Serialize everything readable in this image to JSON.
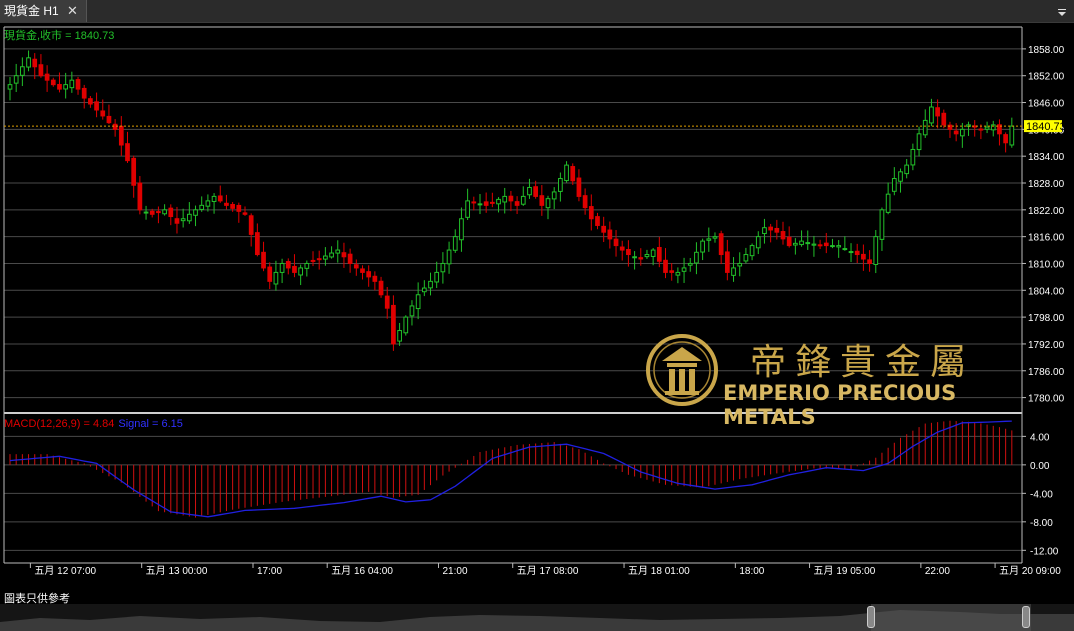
{
  "tab": {
    "title": "現貨金 H1",
    "close": "✕"
  },
  "price_label": "現貨金,收市 = 1840.73",
  "last_price": "1840.73",
  "macd_label": "MACD(12,26,9) = 4.84",
  "signal_label": "Signal = 6.15",
  "footer": "圖表只供參考",
  "logo": {
    "cn": "帝鋒貴金屬",
    "en": "EMPERIO PRECIOUS METALS"
  },
  "colors": {
    "up": "#22c02a",
    "down": "#e00000",
    "signal": "#2020e0",
    "macd_hist": "#d01010",
    "axis_text": "#ffffff",
    "price_line": "#e0a000",
    "price_box": "#ffff00",
    "label_green": "#22c02a",
    "label_red": "#e00000",
    "label_blue": "#3030ff"
  },
  "chart_data": [
    {
      "type": "candlestick",
      "ylim": [
        1777,
        1862
      ],
      "y_ticks": [
        "1858.00",
        "1852.00",
        "1846.00",
        "1840.00",
        "1834.00",
        "1828.00",
        "1822.00",
        "1816.00",
        "1810.00",
        "1804.00",
        "1798.00",
        "1792.00",
        "1786.00",
        "1780.00"
      ],
      "y_tick_values": [
        1858,
        1852,
        1846,
        1840,
        1834,
        1828,
        1822,
        1816,
        1810,
        1804,
        1798,
        1792,
        1786,
        1780
      ],
      "x_ticks": [
        {
          "label": "五月 12 07:00",
          "index": 2
        },
        {
          "label": "五月 13 00:00",
          "index": 20
        },
        {
          "label": "17:00",
          "index": 38
        },
        {
          "label": "五月 16 04:00",
          "index": 50
        },
        {
          "label": "21:00",
          "index": 68
        },
        {
          "label": "五月 17 08:00",
          "index": 80
        },
        {
          "label": "五月 18 01:00",
          "index": 98
        },
        {
          "label": "18:00",
          "index": 116
        },
        {
          "label": "五月 19 05:00",
          "index": 128
        },
        {
          "label": "22:00",
          "index": 146
        },
        {
          "label": "五月 20 09:00",
          "index": 158
        }
      ],
      "close_anchors": [
        [
          0,
          1850
        ],
        [
          3,
          1856
        ],
        [
          5,
          1852
        ],
        [
          8,
          1849
        ],
        [
          10,
          1851
        ],
        [
          12,
          1847
        ],
        [
          15,
          1843
        ],
        [
          17,
          1840
        ],
        [
          19,
          1833
        ],
        [
          21,
          1822
        ],
        [
          23,
          1821
        ],
        [
          25,
          1822
        ],
        [
          27,
          1819
        ],
        [
          30,
          1822
        ],
        [
          33,
          1825
        ],
        [
          35,
          1823
        ],
        [
          38,
          1821
        ],
        [
          40,
          1812
        ],
        [
          42,
          1806
        ],
        [
          44,
          1810
        ],
        [
          46,
          1808
        ],
        [
          48,
          1810
        ],
        [
          50,
          1811
        ],
        [
          53,
          1813
        ],
        [
          55,
          1810
        ],
        [
          57,
          1808
        ],
        [
          59,
          1806
        ],
        [
          61,
          1800
        ],
        [
          62,
          1792
        ],
        [
          64,
          1798
        ],
        [
          66,
          1803
        ],
        [
          68,
          1806
        ],
        [
          70,
          1810
        ],
        [
          72,
          1816
        ],
        [
          74,
          1824
        ],
        [
          77,
          1823
        ],
        [
          80,
          1825
        ],
        [
          82,
          1823
        ],
        [
          84,
          1827
        ],
        [
          86,
          1823
        ],
        [
          88,
          1826
        ],
        [
          90,
          1832
        ],
        [
          92,
          1825
        ],
        [
          94,
          1820
        ],
        [
          96,
          1817
        ],
        [
          98,
          1814
        ],
        [
          100,
          1812
        ],
        [
          102,
          1811
        ],
        [
          104,
          1813
        ],
        [
          106,
          1808
        ],
        [
          108,
          1808
        ],
        [
          110,
          1810
        ],
        [
          112,
          1815
        ],
        [
          114,
          1816
        ],
        [
          116,
          1808
        ],
        [
          118,
          1810
        ],
        [
          120,
          1814
        ],
        [
          122,
          1818
        ],
        [
          124,
          1817
        ],
        [
          126,
          1814
        ],
        [
          128,
          1815
        ],
        [
          131,
          1814
        ],
        [
          134,
          1814
        ],
        [
          137,
          1812
        ],
        [
          139,
          1810
        ],
        [
          141,
          1822
        ],
        [
          143,
          1829
        ],
        [
          145,
          1832
        ],
        [
          147,
          1839
        ],
        [
          149,
          1845
        ],
        [
          151,
          1841
        ],
        [
          153,
          1839
        ],
        [
          155,
          1841
        ],
        [
          157,
          1840
        ],
        [
          159,
          1841
        ],
        [
          161,
          1837
        ],
        [
          162,
          1840.73
        ]
      ],
      "last_price": 1840.73
    },
    {
      "type": "bar+line",
      "name": "MACD(12,26,9)",
      "ylim": [
        -13.5,
        7
      ],
      "y_ticks": [
        "4.00",
        "0.00",
        "-4.00",
        "-8.00",
        "-12.00"
      ],
      "y_tick_values": [
        4,
        0,
        -4,
        -8,
        -12
      ],
      "macd_anchors": [
        [
          0,
          1.5
        ],
        [
          6,
          1.5
        ],
        [
          12,
          0.2
        ],
        [
          18,
          -2.5
        ],
        [
          24,
          -6.5
        ],
        [
          30,
          -7.4
        ],
        [
          36,
          -6.3
        ],
        [
          44,
          -5.2
        ],
        [
          52,
          -4.4
        ],
        [
          58,
          -3.8
        ],
        [
          62,
          -4.6
        ],
        [
          66,
          -4.2
        ],
        [
          70,
          -1.5
        ],
        [
          76,
          1.8
        ],
        [
          82,
          2.8
        ],
        [
          88,
          3.2
        ],
        [
          92,
          2.2
        ],
        [
          96,
          0.2
        ],
        [
          100,
          -1.4
        ],
        [
          106,
          -2.8
        ],
        [
          112,
          -3.2
        ],
        [
          118,
          -2.0
        ],
        [
          124,
          -1.2
        ],
        [
          130,
          -0.5
        ],
        [
          136,
          -0.6
        ],
        [
          140,
          1.0
        ],
        [
          144,
          3.8
        ],
        [
          148,
          5.8
        ],
        [
          152,
          6.2
        ],
        [
          156,
          6.0
        ],
        [
          160,
          5.3
        ],
        [
          162,
          4.84
        ]
      ],
      "signal_anchors": [
        [
          0,
          0.6
        ],
        [
          8,
          1.2
        ],
        [
          14,
          0.2
        ],
        [
          20,
          -3.5
        ],
        [
          26,
          -6.6
        ],
        [
          32,
          -7.3
        ],
        [
          38,
          -6.4
        ],
        [
          46,
          -6.1
        ],
        [
          54,
          -5.3
        ],
        [
          60,
          -4.4
        ],
        [
          64,
          -5.2
        ],
        [
          68,
          -4.9
        ],
        [
          72,
          -3.0
        ],
        [
          78,
          0.9
        ],
        [
          84,
          2.5
        ],
        [
          90,
          2.9
        ],
        [
          96,
          1.6
        ],
        [
          102,
          -1.0
        ],
        [
          108,
          -2.6
        ],
        [
          114,
          -3.4
        ],
        [
          120,
          -2.8
        ],
        [
          126,
          -1.4
        ],
        [
          132,
          -0.4
        ],
        [
          138,
          -0.8
        ],
        [
          142,
          0.2
        ],
        [
          146,
          2.6
        ],
        [
          150,
          4.6
        ],
        [
          154,
          5.9
        ],
        [
          158,
          6.0
        ],
        [
          162,
          6.15
        ]
      ],
      "last_macd": 4.84,
      "last_signal": 6.15
    }
  ]
}
